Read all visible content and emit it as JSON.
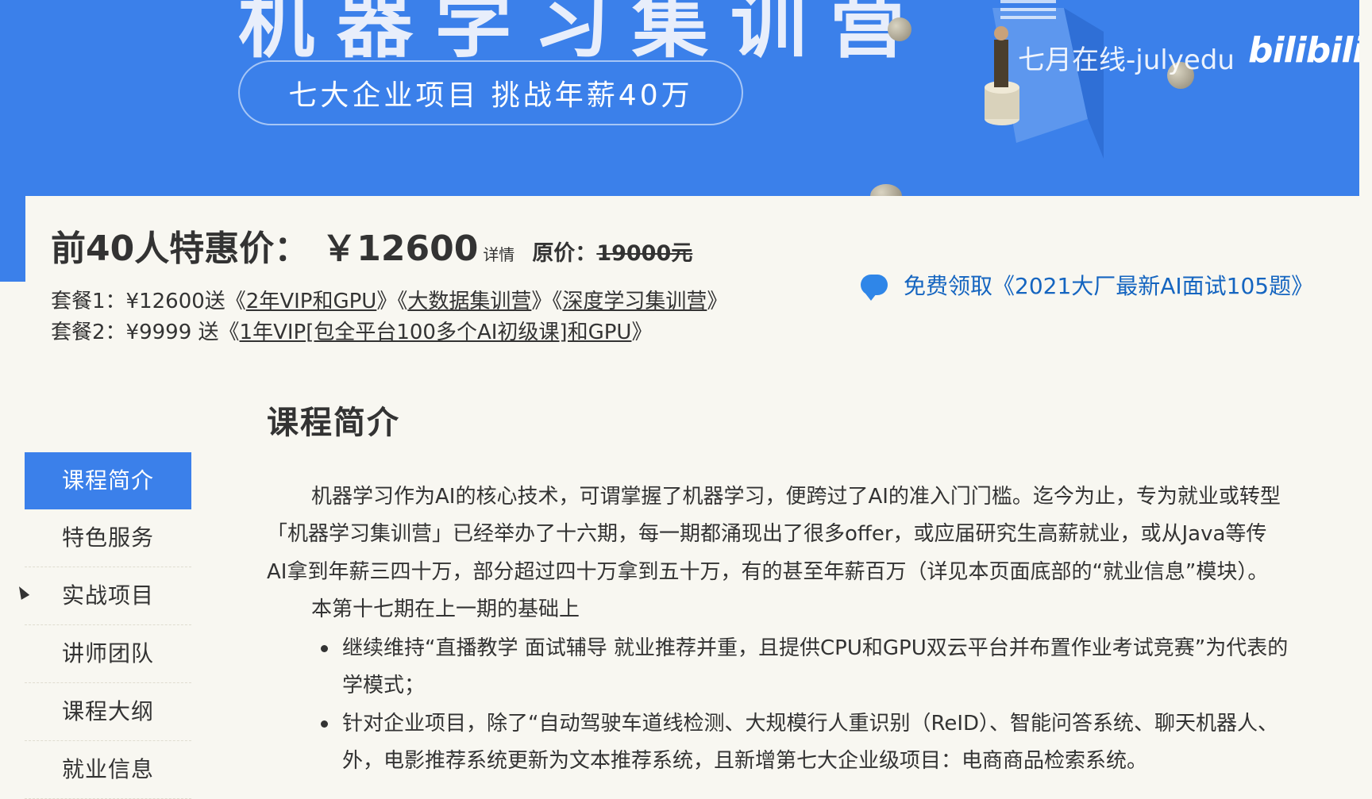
{
  "banner": {
    "title": "机器学习集训营",
    "subtitle": "七大企业项目 挑战年薪40万",
    "watermark": "七月在线-julyedu",
    "logo_text": "bilibili"
  },
  "pricing": {
    "label": "前40人特惠价：",
    "price": "￥12600",
    "details": "详情",
    "original_label": "原价：",
    "original_price": "19000元"
  },
  "packages": [
    {
      "prefix": "套餐1：¥12600送《",
      "link1": "2年VIP和GPU",
      "sep1": "》《",
      "link2": "大数据集训营",
      "sep2": "》《",
      "link3": "深度学习集训营",
      "suffix": "》"
    },
    {
      "prefix": "套餐2：¥9999 送《",
      "link1": "1年VIP[包全平台100多个AI初级课]和GPU",
      "suffix": "》"
    }
  ],
  "free_offer": {
    "text": "免费领取《2021大厂最新AI面试105题》",
    "icon": "chat-bubble-icon"
  },
  "sidebar": {
    "items": [
      {
        "label": "课程简介",
        "active": true
      },
      {
        "label": "特色服务",
        "active": false
      },
      {
        "label": "实战项目",
        "active": false
      },
      {
        "label": "讲师团队",
        "active": false
      },
      {
        "label": "课程大纲",
        "active": false
      },
      {
        "label": "就业信息",
        "active": false
      }
    ]
  },
  "content": {
    "section_title": "课程简介",
    "lines": [
      "机器学习作为AI的核心技术，可谓掌握了机器学习，便跨过了AI的准入门门槛。迄今为止，专为就业或转型",
      "「机器学习集训营」已经举办了十六期，每一期都涌现出了很多offer，或应届研究生高薪就业，或从Java等传",
      "AI拿到年薪三四十万，部分超过四十万拿到五十万，有的甚至年薪百万（详见本页面底部的“就业信息”模块）。",
      "本第十七期在上一期的基础上"
    ],
    "bullets": [
      {
        "line1": "继续维持“直播教学 面试辅导 就业推荐并重，且提供CPU和GPU双云平台并布置作业考试竞赛”为代表的",
        "line2": "学模式；"
      },
      {
        "line1": "针对企业项目，除了“自动驾驶车道线检测、大规模行人重识别（ReID）、智能问答系统、聊天机器人、",
        "line2": "外，电影推荐系统更新为文本推荐系统，且新增第七大企业级项目：电商商品检索系统。"
      }
    ]
  },
  "colors": {
    "banner_blue": "#3b80ea",
    "link_blue": "#1565c0",
    "page_bg": "#f8f7f1"
  }
}
